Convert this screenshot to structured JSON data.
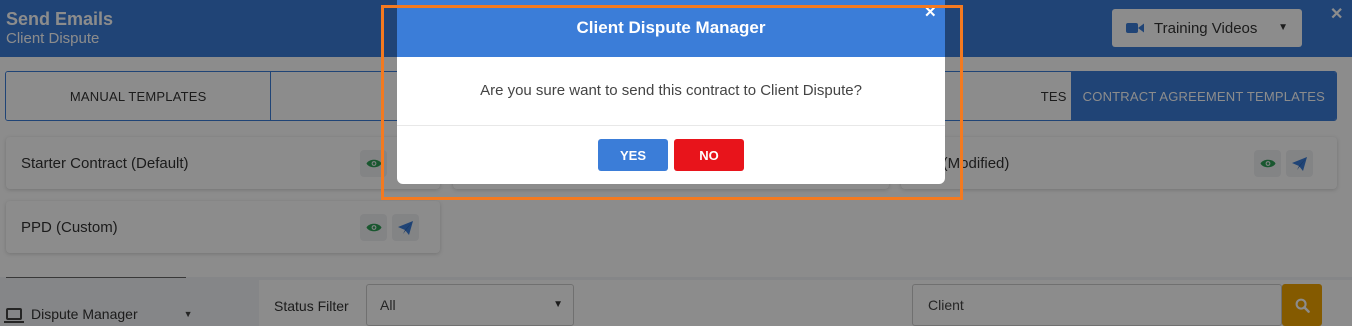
{
  "background": {
    "sidebar_item": "Dispute Manager",
    "status_filter_label": "Status Filter",
    "status_filter_value": "All",
    "search_value": "Client"
  },
  "send_modal": {
    "title": "Send Emails",
    "subtitle": "Client Dispute",
    "training_button": "Training Videos",
    "tabs": [
      {
        "label": "MANUAL TEMPLATES",
        "active": false
      },
      {
        "label": "",
        "active": false
      },
      {
        "label": "",
        "active": false
      },
      {
        "label": "TES",
        "active": false
      },
      {
        "label": "CONTRACT AGREEMENT TEMPLATES",
        "active": true
      }
    ],
    "templates": [
      {
        "name": "Starter Contract (Default)"
      },
      {
        "name": ""
      },
      {
        "name": "n B (Modified)"
      },
      {
        "name": "PPD (Custom)"
      }
    ]
  },
  "dialog": {
    "title": "Client Dispute Manager",
    "message": "Are you sure want to send this contract to Client Dispute?",
    "yes_label": "YES",
    "no_label": "NO"
  },
  "colors": {
    "primary": "#3b7dd8",
    "danger": "#e8141b",
    "view_icon": "#2e9e56",
    "search_button": "#f0a500",
    "highlight": "#f47a20"
  },
  "icons": {
    "close": "close-icon",
    "training": "video-camera-icon",
    "view": "eye-icon",
    "send": "paper-plane-icon",
    "search": "search-icon",
    "sidebar": "laptop-icon"
  }
}
